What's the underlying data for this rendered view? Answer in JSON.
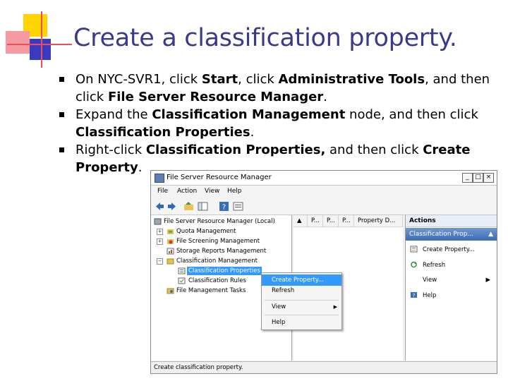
{
  "slide": {
    "title": "Create a classification property.",
    "bullets": [
      {
        "parts": [
          "On NYC-SVR1, click ",
          "Start",
          ", click ",
          "Administrative Tools",
          ", and then click ",
          "File Server Resource Manager",
          "."
        ]
      },
      {
        "parts": [
          "Expand the ",
          "Classification Management",
          " node, and then click ",
          "Classification Properties",
          "."
        ]
      },
      {
        "parts": [
          "Right-click ",
          "Classification Properties,",
          " and then click ",
          "Create Property",
          "."
        ]
      }
    ]
  },
  "window": {
    "title": "File Server Resource Manager",
    "buttons": {
      "minimize": "_",
      "maximize": "□",
      "close": "×"
    },
    "menu": [
      "File",
      "Action",
      "View",
      "Help"
    ],
    "toolbar_icons": [
      "back-arrow-icon",
      "forward-arrow-icon",
      "up-folder-icon",
      "show-hide-tree-icon",
      "help-icon",
      "properties-icon"
    ],
    "tree": {
      "root": "File Server Resource Manager (Local)",
      "items": [
        {
          "label": "Quota Management",
          "expander": "+"
        },
        {
          "label": "File Screening Management",
          "expander": "+"
        },
        {
          "label": "Storage Reports Management",
          "expander": ""
        },
        {
          "label": "Classification Management",
          "expander": "−"
        },
        {
          "label": "Classification Properties",
          "expander": "",
          "selected": true
        },
        {
          "label": "Classification Rules",
          "expander": ""
        },
        {
          "label": "File Management Tasks",
          "expander": ""
        }
      ]
    },
    "list_headers": [
      "P...",
      "P...",
      "P...",
      "Property D..."
    ],
    "actions": {
      "header": "Actions",
      "section": "Classification Prop...",
      "section_arrow": "▲",
      "items": [
        {
          "label": "Create Property...",
          "icon": "create-property-icon"
        },
        {
          "label": "Refresh",
          "icon": "refresh-icon"
        },
        {
          "label": "View",
          "icon": "",
          "arrow": "▶"
        },
        {
          "label": "Help",
          "icon": "help-icon"
        }
      ]
    },
    "context_menu": [
      {
        "label": "Create Property...",
        "highlight": true
      },
      {
        "label": "Refresh"
      },
      {
        "label": "View",
        "arrow": "▶"
      },
      {
        "label": "Help"
      }
    ],
    "status": "Create classification property."
  },
  "colors": {
    "title": "#3a3a8c",
    "accent_yellow": "#ffd400",
    "accent_red": "#e8505b",
    "selection": "#3399ff"
  }
}
